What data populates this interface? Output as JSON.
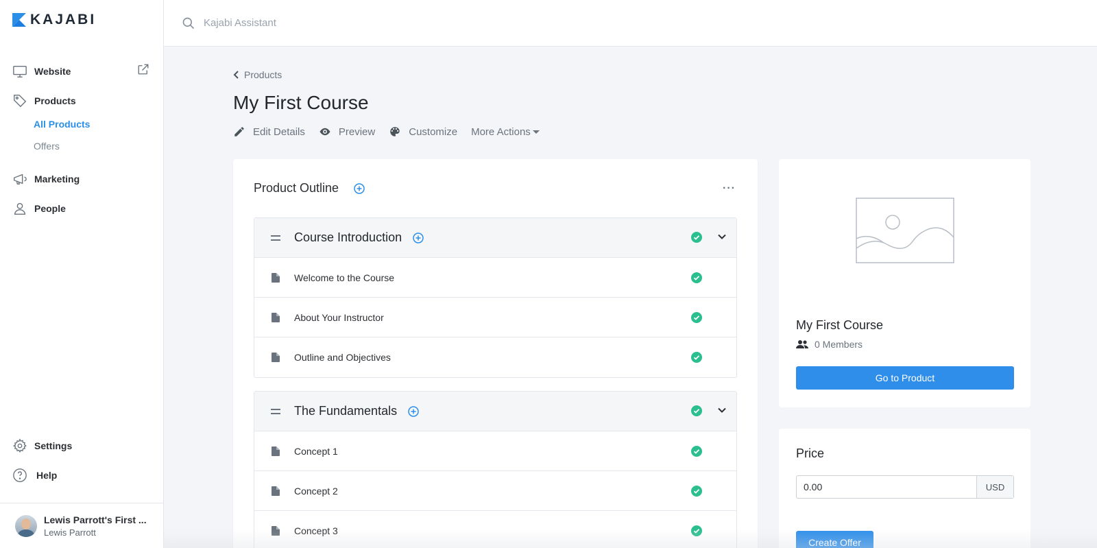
{
  "brand": {
    "name": "KAJABI",
    "accent": "#2e8eea",
    "logo_color": "#2b8fe8"
  },
  "sidebar": {
    "items": [
      {
        "label": "Website",
        "icon": "monitor-icon"
      },
      {
        "label": "Products",
        "icon": "tag-icon"
      },
      {
        "label": "Marketing",
        "icon": "megaphone-icon"
      },
      {
        "label": "People",
        "icon": "person-icon"
      }
    ],
    "products_sub": [
      {
        "label": "All Products",
        "active": true
      },
      {
        "label": "Offers",
        "active": false
      }
    ],
    "bottom": [
      {
        "label": "Settings",
        "icon": "gear-icon"
      },
      {
        "label": "Help",
        "icon": "help-icon"
      }
    ],
    "account": {
      "site": "Lewis Parrott's First ...",
      "user": "Lewis Parrott"
    }
  },
  "search": {
    "placeholder": "Kajabi Assistant"
  },
  "breadcrumb": {
    "label": "Products"
  },
  "page": {
    "title": "My First Course"
  },
  "actions": {
    "edit": "Edit Details",
    "preview": "Preview",
    "customize": "Customize",
    "more": "More Actions"
  },
  "outline": {
    "title": "Product Outline",
    "more": "···",
    "modules": [
      {
        "title": "Course Introduction",
        "lessons": [
          "Welcome to the Course",
          "About Your Instructor",
          "Outline and Objectives"
        ]
      },
      {
        "title": "The Fundamentals",
        "lessons": [
          "Concept 1",
          "Concept 2",
          "Concept 3"
        ]
      }
    ]
  },
  "product_card": {
    "title": "My First Course",
    "members": "0 Members",
    "button": "Go to Product"
  },
  "price_card": {
    "title": "Price",
    "value": "0.00",
    "currency": "USD",
    "button": "Create Offer"
  },
  "colors": {
    "check": "#2bbf8f",
    "link": "#2b8fe8"
  }
}
